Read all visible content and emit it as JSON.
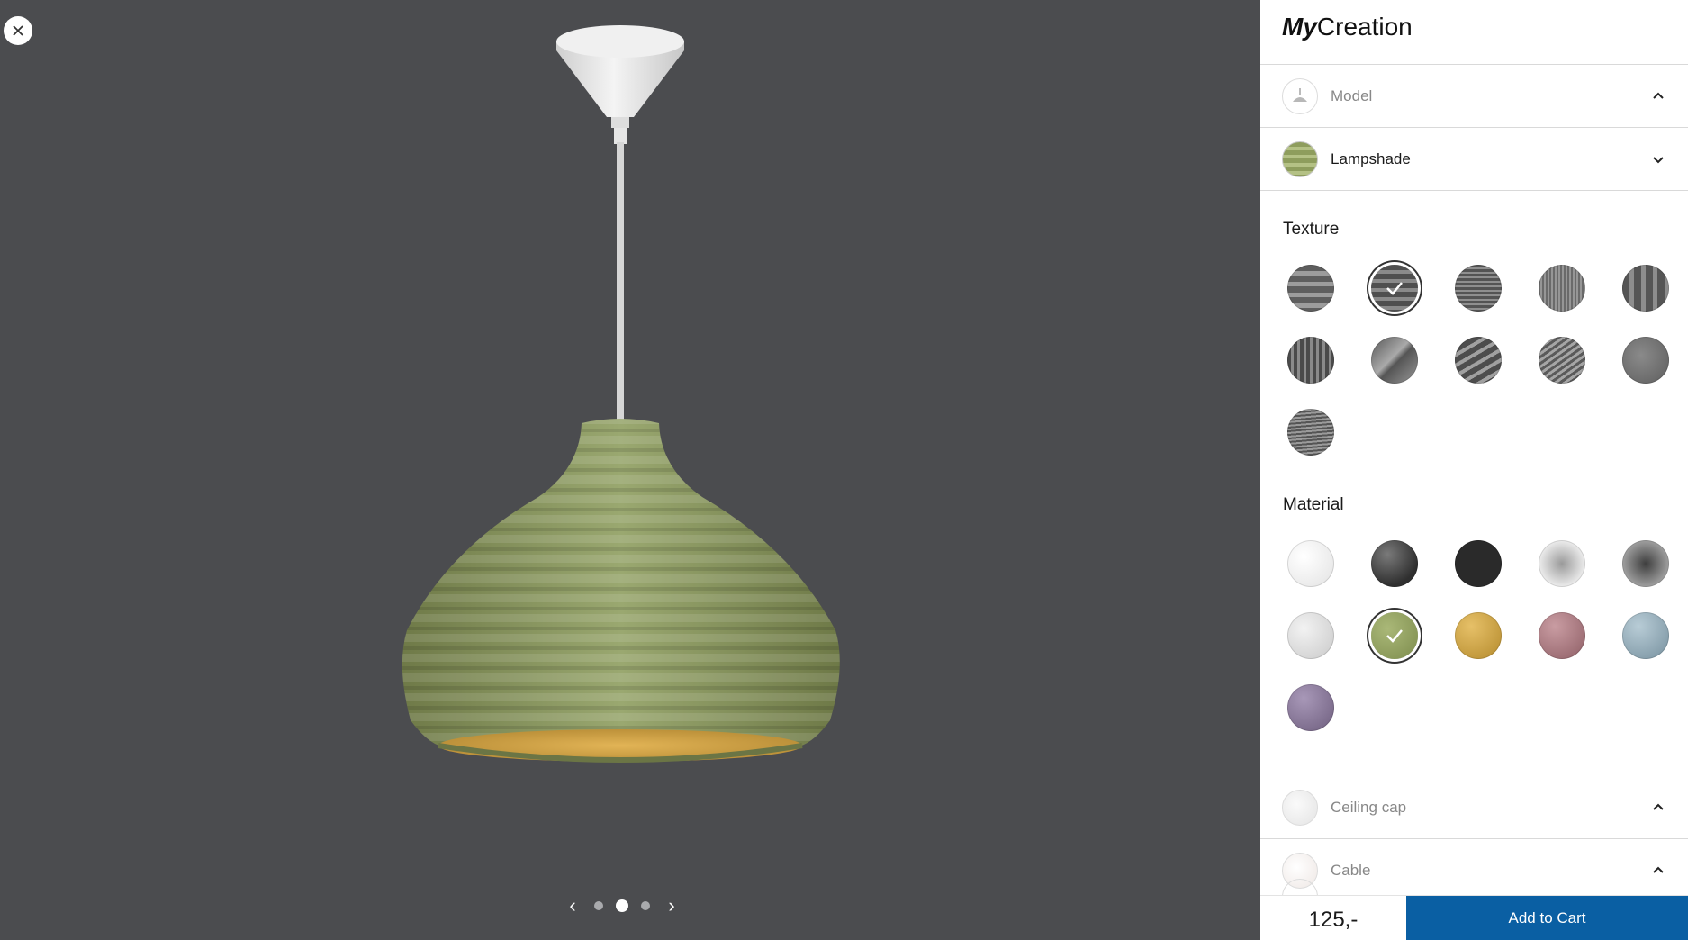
{
  "brand": {
    "part1": "My",
    "part2": "Creation"
  },
  "viewer": {
    "close_icon": "close-icon",
    "carousel": {
      "prev_icon": "chevron-left-icon",
      "next_icon": "chevron-right-icon",
      "active_index": 2,
      "count": 3
    }
  },
  "accordion": {
    "model": {
      "label": "Model",
      "icon": "chevron-up-icon"
    },
    "lampshade": {
      "label": "Lampshade",
      "icon": "chevron-down-icon"
    },
    "ceiling_cap": {
      "label": "Ceiling cap",
      "icon": "chevron-up-icon"
    },
    "cable": {
      "label": "Cable",
      "icon": "chevron-up-icon"
    }
  },
  "texture": {
    "title": "Texture",
    "selected_index": 2,
    "count": 11
  },
  "material": {
    "title": "Material",
    "selected_index": 7,
    "colors": [
      "#eeeeee",
      "#3a3a3a",
      "#2a2a2a",
      "#d8d8d8",
      "#7a7a7a",
      "#d4d4d4",
      "#8a9a55",
      "#c9a040",
      "#a87a80",
      "#8aa2b0",
      "#8a7898"
    ]
  },
  "cart": {
    "price": "125,-",
    "add_label": "Add to Cart"
  },
  "colors": {
    "accent": "#0a5fa3",
    "viewer_bg": "#4b4c4f",
    "lampshade": "#8a9a5e"
  }
}
